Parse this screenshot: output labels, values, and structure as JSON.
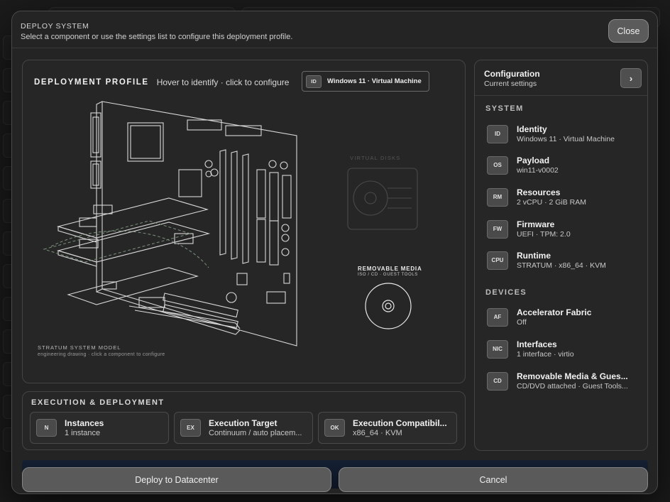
{
  "modal": {
    "title": "DEPLOY SYSTEM",
    "subtitle": "Select a component or use the settings list to configure this deployment profile.",
    "close_label": "Close"
  },
  "profile": {
    "title": "DEPLOYMENT PROFILE",
    "hint": "Hover to identify · click to configure",
    "chip_tag": "ID",
    "chip_label": "Windows 11 · Virtual Machine",
    "model_caption": "STRATUM SYSTEM MODEL",
    "model_sub": "engineering drawing · click a component to configure",
    "virtual_disks_label": "VIRTUAL DISKS",
    "removable_label": "REMOVABLE MEDIA",
    "removable_sub": "ISO / CD · GUEST TOOLS"
  },
  "execution": {
    "title": "EXECUTION & DEPLOYMENT",
    "cards": [
      {
        "tag": "N",
        "title": "Instances",
        "value": "1 instance"
      },
      {
        "tag": "EX",
        "title": "Execution Target",
        "value": "Continuum / auto placem..."
      },
      {
        "tag": "OK",
        "title": "Execution Compatibil...",
        "value": "x86_64 · KVM"
      }
    ]
  },
  "config": {
    "title": "Configuration",
    "subtitle": "Current settings",
    "arrow_icon": "chevron-right-icon",
    "system_label": "SYSTEM",
    "system_items": [
      {
        "tag": "ID",
        "title": "Identity",
        "value": "Windows 11 · Virtual Machine"
      },
      {
        "tag": "OS",
        "title": "Payload",
        "value": "win11-v0002"
      },
      {
        "tag": "RM",
        "title": "Resources",
        "value": "2 vCPU · 2 GiB RAM"
      },
      {
        "tag": "FW",
        "title": "Firmware",
        "value": "UEFI · TPM: 2.0"
      },
      {
        "tag": "CPU",
        "title": "Runtime",
        "value": "STRATUM · x86_64 · KVM"
      }
    ],
    "devices_label": "DEVICES",
    "device_items": [
      {
        "tag": "AF",
        "title": "Accelerator Fabric",
        "value": "Off"
      },
      {
        "tag": "NIC",
        "title": "Interfaces",
        "value": "1 interface · virtio"
      },
      {
        "tag": "CD",
        "title": "Removable Media & Gues...",
        "value": "CD/DVD attached · Guest Tools..."
      }
    ]
  },
  "footer": {
    "deploy_label": "Deploy to Datacenter",
    "cancel_label": "Cancel"
  },
  "colors": {
    "modal_bg": "#242424",
    "panel_border": "#444444",
    "button_bg": "#5a5a5a"
  }
}
